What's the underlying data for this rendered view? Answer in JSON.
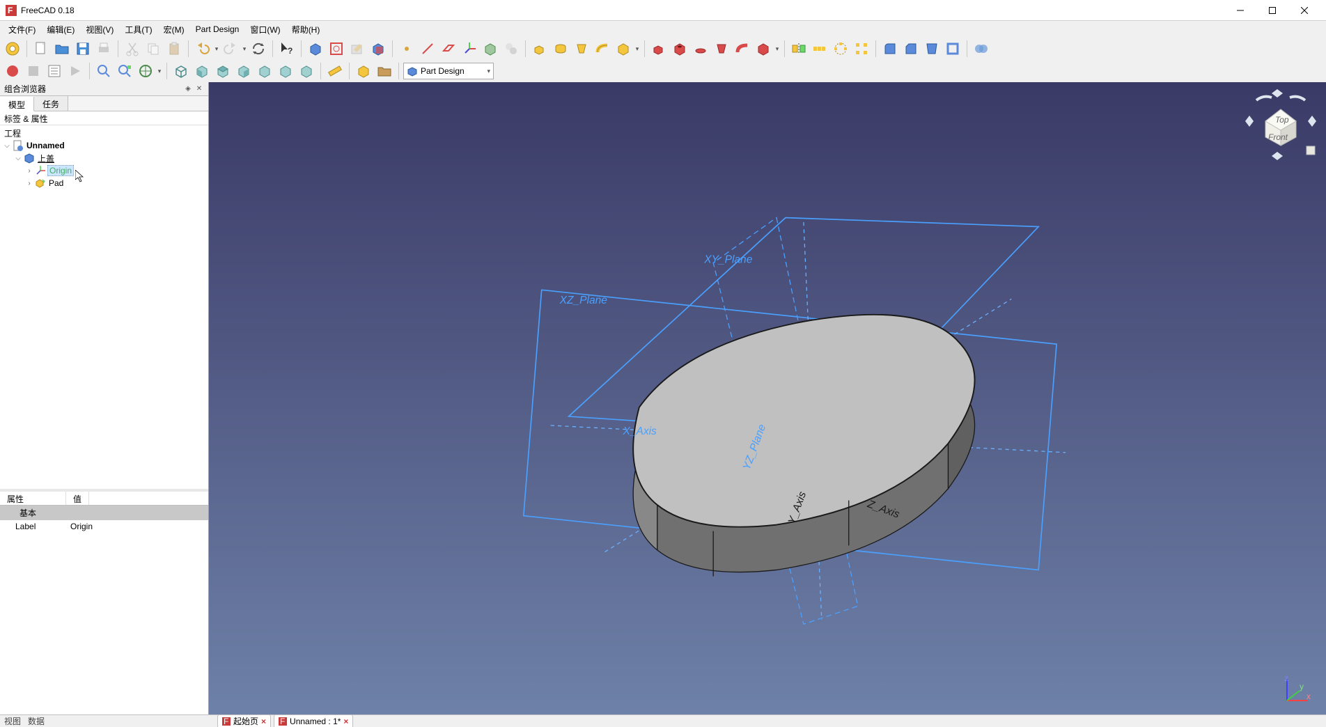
{
  "titlebar": {
    "title": "FreeCAD 0.18"
  },
  "menubar": {
    "file": "文件(F)",
    "edit": "编辑(E)",
    "view": "视图(V)",
    "tools": "工具(T)",
    "macro": "宏(M)",
    "partdesign": "Part Design",
    "window": "窗口(W)",
    "help": "帮助(H)"
  },
  "workbench": {
    "selected": "Part Design"
  },
  "panel": {
    "combo_title": "组合浏览器",
    "tab_model": "模型",
    "tab_tasks": "任务",
    "labels_attrs": "标签 & 属性",
    "project": "工程"
  },
  "tree": {
    "root": "Unnamed",
    "body": "上盖",
    "origin": "Origin",
    "pad": "Pad"
  },
  "props": {
    "col_prop": "属性",
    "col_val": "值",
    "group_basic": "基本",
    "label_key": "Label",
    "label_val": "Origin"
  },
  "viewport": {
    "xy_plane": "XY_Plane",
    "xz_plane": "XZ_Plane",
    "yz_plane": "YZ_Plane",
    "x_axis": "X_Axis",
    "y_axis": "Y_Axis",
    "z_axis": "Z_Axis",
    "navcube_top": "Top",
    "navcube_front": "Front"
  },
  "statusbar": {
    "view_tab": "视图",
    "data_tab": "数据",
    "doc_start": "起始页",
    "doc_unnamed": "Unnamed : 1*"
  }
}
